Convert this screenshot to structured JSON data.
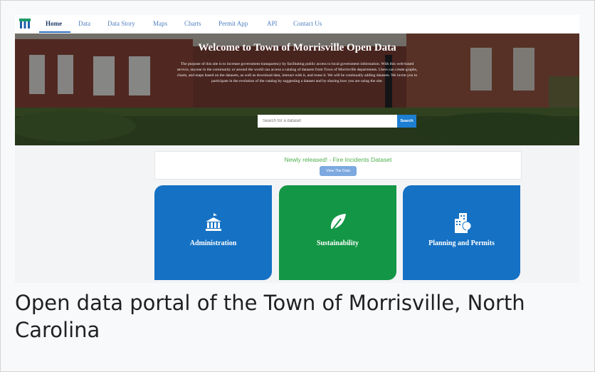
{
  "nav": {
    "items": [
      {
        "label": "Home",
        "active": true
      },
      {
        "label": "Data",
        "active": false
      },
      {
        "label": "Data Story",
        "active": false
      },
      {
        "label": "Maps",
        "active": false
      },
      {
        "label": "Charts",
        "active": false
      },
      {
        "label": "Permit App",
        "active": false
      },
      {
        "label": "API",
        "active": false
      },
      {
        "label": "Contact Us",
        "active": false
      }
    ]
  },
  "hero": {
    "title": "Welcome to Town of Morrisville Open Data",
    "description": "The purpose of this site is to increase government transparency by facilitating public access to local government information. With this web-based service, anyone in the community or around the world can access a catalog of datasets from Town of Morrisville departments. Users can create graphs, charts, and maps based on the datasets, as well as download data, interact with it, and reuse it. We will be continually adding datasets. We invite you to participate in the evolution of the catalog by suggesting a dataset and by sharing how you are using the site.",
    "search_placeholder": "Search for a dataset",
    "search_button": "Search"
  },
  "release": {
    "text": "Newly released! - Fire Incidents Dataset",
    "button": "View The Data"
  },
  "tiles": [
    {
      "label": "Administration",
      "icon": "government-building-icon",
      "color": "#1571c4"
    },
    {
      "label": "Sustainability",
      "icon": "leaf-icon",
      "color": "#139645"
    },
    {
      "label": "Planning and Permits",
      "icon": "building-tree-icon",
      "color": "#1571c4"
    }
  ],
  "caption": "Open data portal of the Town of Morrisville, North Carolina",
  "colors": {
    "accent": "#2e6fc0",
    "search_button": "#1d7ed2",
    "release_text": "#4fae4d"
  }
}
